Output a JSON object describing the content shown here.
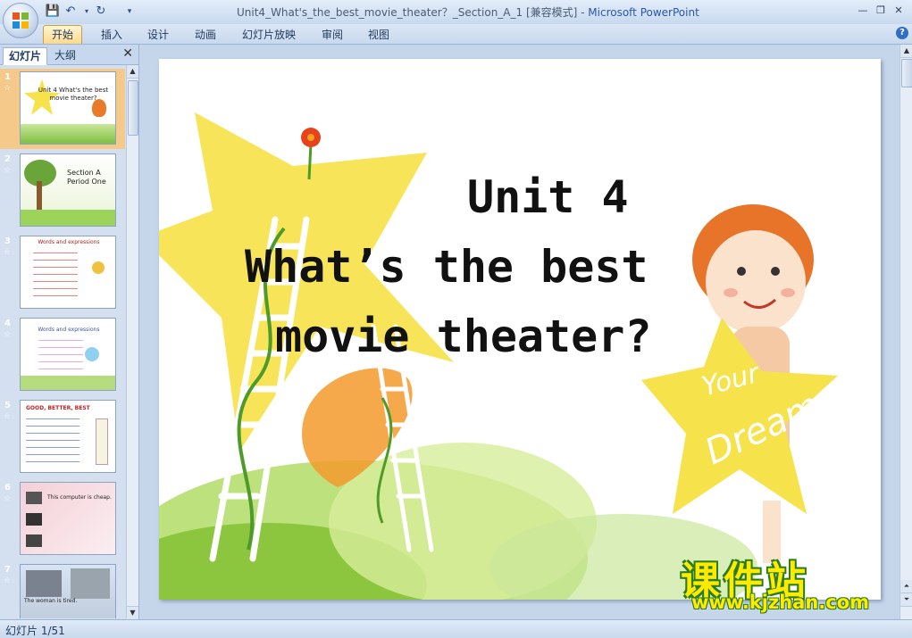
{
  "window": {
    "title": "Unit4_What's_the_best_movie_theater？_Section_A_1 [兼容模式] - ",
    "app_name": "Microsoft PowerPoint"
  },
  "ribbon": {
    "tabs": [
      {
        "label": "开始",
        "active": true
      },
      {
        "label": "插入"
      },
      {
        "label": "设计"
      },
      {
        "label": "动画"
      },
      {
        "label": "幻灯片放映"
      },
      {
        "label": "审阅"
      },
      {
        "label": "视图"
      }
    ]
  },
  "left_pane": {
    "tabs": [
      {
        "label": "幻灯片",
        "active": true
      },
      {
        "label": "大纲"
      }
    ],
    "slides": [
      {
        "number": "1",
        "text": "Unit 4 What's the best movie theater?"
      },
      {
        "number": "2",
        "text": "Section A Period One"
      },
      {
        "number": "3",
        "text": "Words and expressions"
      },
      {
        "number": "4",
        "text": "Words and expressions"
      },
      {
        "number": "5",
        "text": "GOOD, BETTER, BEST"
      },
      {
        "number": "6",
        "text": "This computer is cheap."
      },
      {
        "number": "7",
        "text": "The woman is tired."
      }
    ]
  },
  "slide": {
    "title_line1": "Unit 4",
    "title_line2": "What’s the best",
    "title_line3": "movie theater?",
    "star_text_1": "Your",
    "star_text_2": "Dream"
  },
  "watermark": {
    "brand": "课件站",
    "url": "www.kjzhan.com"
  },
  "status": {
    "slide_indicator": "幻灯片 1/51"
  },
  "colors": {
    "selected_thumb": "#f5c98a",
    "star_yellow": "#f6e24a",
    "grass_green": "#8cc63f",
    "brand_yellow": "#ffea00"
  }
}
